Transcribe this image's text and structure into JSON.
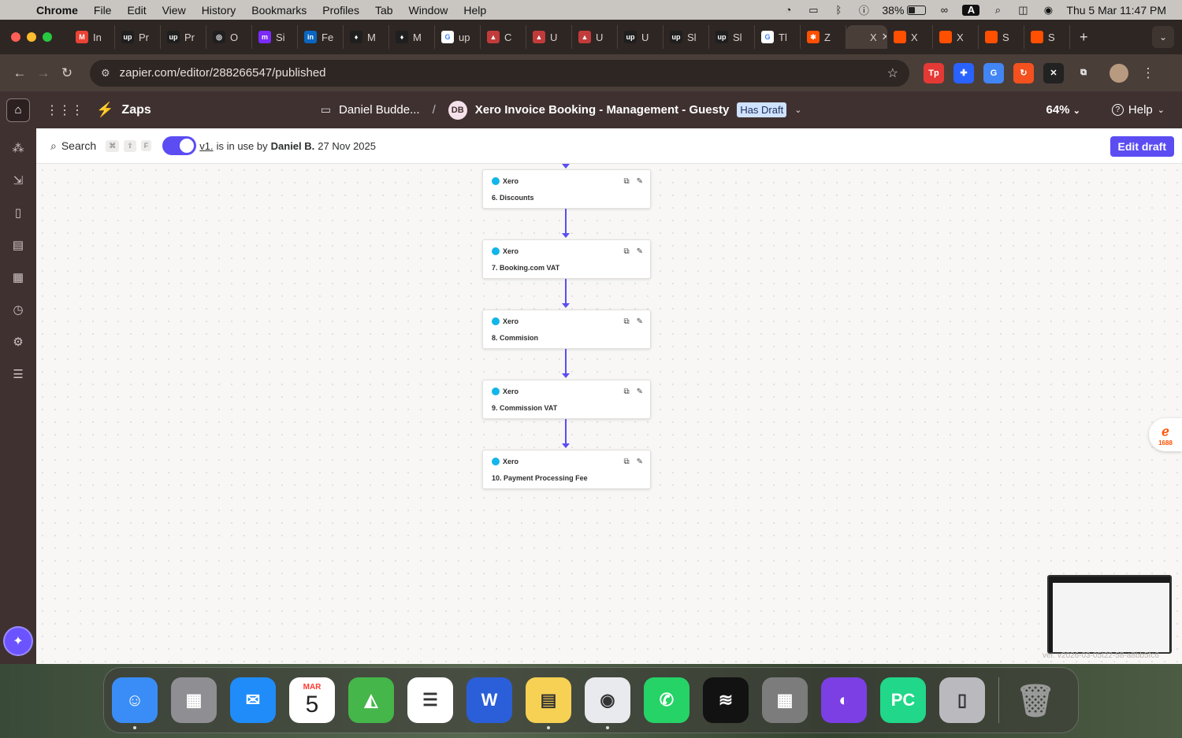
{
  "menubar": {
    "app": "Chrome",
    "items": [
      "File",
      "Edit",
      "View",
      "History",
      "Bookmarks",
      "Profiles",
      "Tab",
      "Window",
      "Help"
    ],
    "battery": "38%",
    "battery_level": 0.38,
    "input_source": "A",
    "clock": "Thu 5 Mar  11:47 PM"
  },
  "tabs": [
    {
      "label": "In",
      "icon": "gmail-icon",
      "color": "#ea4335",
      "glyph": "M"
    },
    {
      "label": "Pr",
      "icon": "upwork-icon",
      "color": "#1f1f1f",
      "glyph": "up"
    },
    {
      "label": "Pr",
      "icon": "upwork-icon",
      "color": "#1f1f1f",
      "glyph": "up"
    },
    {
      "label": "O",
      "icon": "openai-icon",
      "color": "#1f1f1f",
      "glyph": "◎"
    },
    {
      "label": "Si",
      "icon": "make-icon",
      "color": "#7b2bf9",
      "glyph": "m"
    },
    {
      "label": "Fe",
      "icon": "linkedin-icon",
      "color": "#0a66c2",
      "glyph": "in"
    },
    {
      "label": "M",
      "icon": "mongodb-icon",
      "color": "#1f1f1f",
      "glyph": "♦"
    },
    {
      "label": "M",
      "icon": "mongodb-icon",
      "color": "#1f1f1f",
      "glyph": "♦"
    },
    {
      "label": "up",
      "icon": "google-icon",
      "color": "#ffffff",
      "glyph": "G"
    },
    {
      "label": "C",
      "icon": "booking-icon",
      "color": "#c23b3b",
      "glyph": "▲"
    },
    {
      "label": "U",
      "icon": "booking-icon",
      "color": "#c23b3b",
      "glyph": "▲"
    },
    {
      "label": "U",
      "icon": "booking-icon",
      "color": "#c23b3b",
      "glyph": "▲"
    },
    {
      "label": "U",
      "icon": "upwork-icon",
      "color": "#1f1f1f",
      "glyph": "up"
    },
    {
      "label": "Sl",
      "icon": "upwork-icon",
      "color": "#1f1f1f",
      "glyph": "up"
    },
    {
      "label": "Sl",
      "icon": "upwork-icon",
      "color": "#1f1f1f",
      "glyph": "up"
    },
    {
      "label": "Tl",
      "icon": "google-icon",
      "color": "#ffffff",
      "glyph": "G"
    },
    {
      "label": "Z",
      "icon": "zapier-icon",
      "color": "#ff4f00",
      "glyph": "✱"
    },
    {
      "label": "X",
      "icon": "xero-icon",
      "color": "#4a3e39",
      "glyph": "",
      "active": true
    },
    {
      "label": "X",
      "icon": "orange-square-icon",
      "color": "#ff4f00",
      "glyph": ""
    },
    {
      "label": "X",
      "icon": "orange-square-icon",
      "color": "#ff4f00",
      "glyph": ""
    },
    {
      "label": "S",
      "icon": "orange-square-icon",
      "color": "#ff4f00",
      "glyph": ""
    },
    {
      "label": "S",
      "icon": "orange-square-icon",
      "color": "#ff4f00",
      "glyph": ""
    }
  ],
  "address": {
    "url": "zapier.com/editor/288266547/published"
  },
  "extensions": [
    {
      "name": "tp-extension-icon",
      "glyph": "Tp",
      "color": "#e53935"
    },
    {
      "name": "puzzle-blue-extension-icon",
      "glyph": "✚",
      "color": "#2962ff"
    },
    {
      "name": "translate-extension-icon",
      "glyph": "G",
      "color": "#4285f4"
    },
    {
      "name": "reload-extension-icon",
      "glyph": "↻",
      "color": "#f4511e"
    },
    {
      "name": "x-extension-icon",
      "glyph": "✕",
      "color": "#222222"
    },
    {
      "name": "puzzle-extension-icon",
      "glyph": "⧉",
      "color": "transparent"
    }
  ],
  "zapier": {
    "section": "Zaps",
    "folder": "Daniel Budde...",
    "owner_initials": "DB",
    "zap_title": "Xero Invoice Booking - Management - Guesty",
    "draft_badge": "Has Draft",
    "zoom": "64%",
    "help": "Help",
    "search": "Search",
    "shortcut": [
      "⌘",
      "⇧",
      "F"
    ],
    "version": "v1.",
    "in_use_by": "is in use by",
    "user": "Daniel B.",
    "date": "27 Nov 2025",
    "edit_draft": "Edit draft"
  },
  "steps": [
    {
      "app": "Xero",
      "number": "6.",
      "name": "Discounts"
    },
    {
      "app": "Xero",
      "number": "7.",
      "name": "Booking.com VAT"
    },
    {
      "app": "Xero",
      "number": "8.",
      "name": "Commision"
    },
    {
      "app": "Xero",
      "number": "9.",
      "name": "Commission VAT"
    },
    {
      "app": "Xero",
      "number": "10.",
      "name": "Payment Processing Fee"
    }
  ],
  "side_badge": {
    "label": "1688"
  },
  "version_footer": "ver. v2026-03-05t22-58-a8bb5fc6",
  "dock": [
    {
      "name": "finder-app",
      "glyph": "☺",
      "color": "#3a8df6"
    },
    {
      "name": "launchpad-app",
      "glyph": "▦",
      "color": "#8e8e93"
    },
    {
      "name": "mail-app",
      "glyph": "✉",
      "color": "#1f8cf9"
    },
    {
      "name": "calendar-app",
      "glyph": "",
      "color": "#ffffff"
    },
    {
      "name": "maps-app",
      "glyph": "◭",
      "color": "#45b649"
    },
    {
      "name": "reminders-app",
      "glyph": "☰",
      "color": "#ffffff"
    },
    {
      "name": "word-app",
      "glyph": "W",
      "color": "#2b5fd9"
    },
    {
      "name": "notes-app",
      "glyph": "▤",
      "color": "#f7d154"
    },
    {
      "name": "chrome-app",
      "glyph": "◉",
      "color": "#e8eaed"
    },
    {
      "name": "whatsapp-app",
      "glyph": "✆",
      "color": "#25d366"
    },
    {
      "name": "spotify-app",
      "glyph": "≋",
      "color": "#121212"
    },
    {
      "name": "calculator-app",
      "glyph": "▦",
      "color": "#7c7c7c"
    },
    {
      "name": "firefox-app",
      "glyph": "◐",
      "color": "#7b3fe4"
    },
    {
      "name": "pycharm-app",
      "glyph": "PC",
      "color": "#21d789"
    },
    {
      "name": "iphone-mirroring-app",
      "glyph": "▯",
      "color": "#b9b9be"
    }
  ],
  "calendar": {
    "month": "MAR",
    "day": "5"
  }
}
